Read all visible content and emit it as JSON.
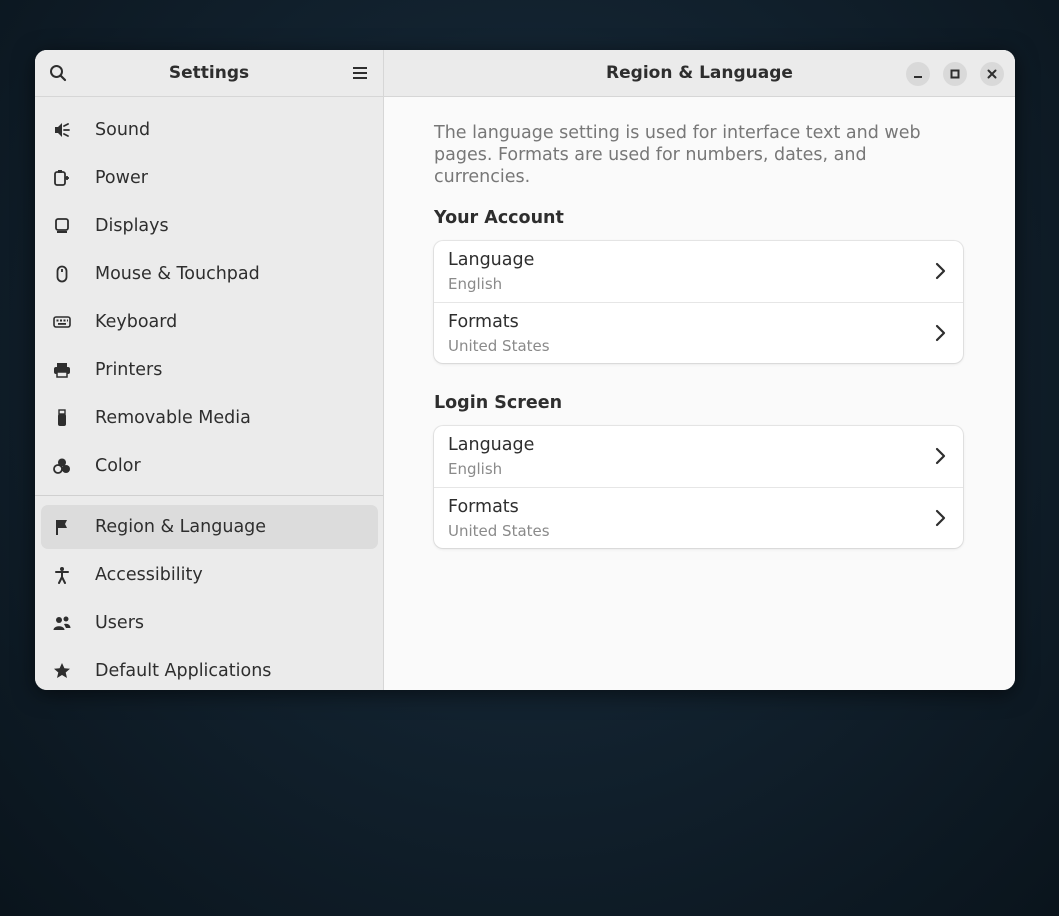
{
  "sidebar": {
    "title": "Settings",
    "search_icon": "search-icon",
    "menu_icon": "hamburger-menu-icon",
    "items": [
      {
        "label": "Sound",
        "icon": "speaker-icon"
      },
      {
        "label": "Power",
        "icon": "power-plug-icon"
      },
      {
        "label": "Displays",
        "icon": "display-icon"
      },
      {
        "label": "Mouse & Touchpad",
        "icon": "mouse-icon"
      },
      {
        "label": "Keyboard",
        "icon": "keyboard-icon"
      },
      {
        "label": "Printers",
        "icon": "printer-icon"
      },
      {
        "label": "Removable Media",
        "icon": "usb-drive-icon"
      },
      {
        "label": "Color",
        "icon": "color-icon"
      },
      {
        "label": "Region & Language",
        "icon": "flag-icon",
        "active": true
      },
      {
        "label": "Accessibility",
        "icon": "accessibility-icon"
      },
      {
        "label": "Users",
        "icon": "users-icon"
      },
      {
        "label": "Default Applications",
        "icon": "star-icon"
      }
    ]
  },
  "main": {
    "title": "Region & Language",
    "description": "The language setting is used for interface text and web pages. Formats are used for numbers, dates, and currencies.",
    "groups": [
      {
        "title": "Your Account",
        "rows": [
          {
            "title": "Language",
            "value": "English"
          },
          {
            "title": "Formats",
            "value": "United States"
          }
        ]
      },
      {
        "title": "Login Screen",
        "rows": [
          {
            "title": "Language",
            "value": "English"
          },
          {
            "title": "Formats",
            "value": "United States"
          }
        ]
      }
    ]
  },
  "window_controls": {
    "minimize_icon": "minimize-icon",
    "maximize_icon": "maximize-icon",
    "close_icon": "close-icon"
  },
  "colors": {
    "sidebar_bg": "#ebebeb",
    "active_item_bg": "#dcdcdc",
    "content_bg": "#fafafa",
    "text": "#2e2e2e",
    "secondary_text": "#8a8a8a"
  }
}
